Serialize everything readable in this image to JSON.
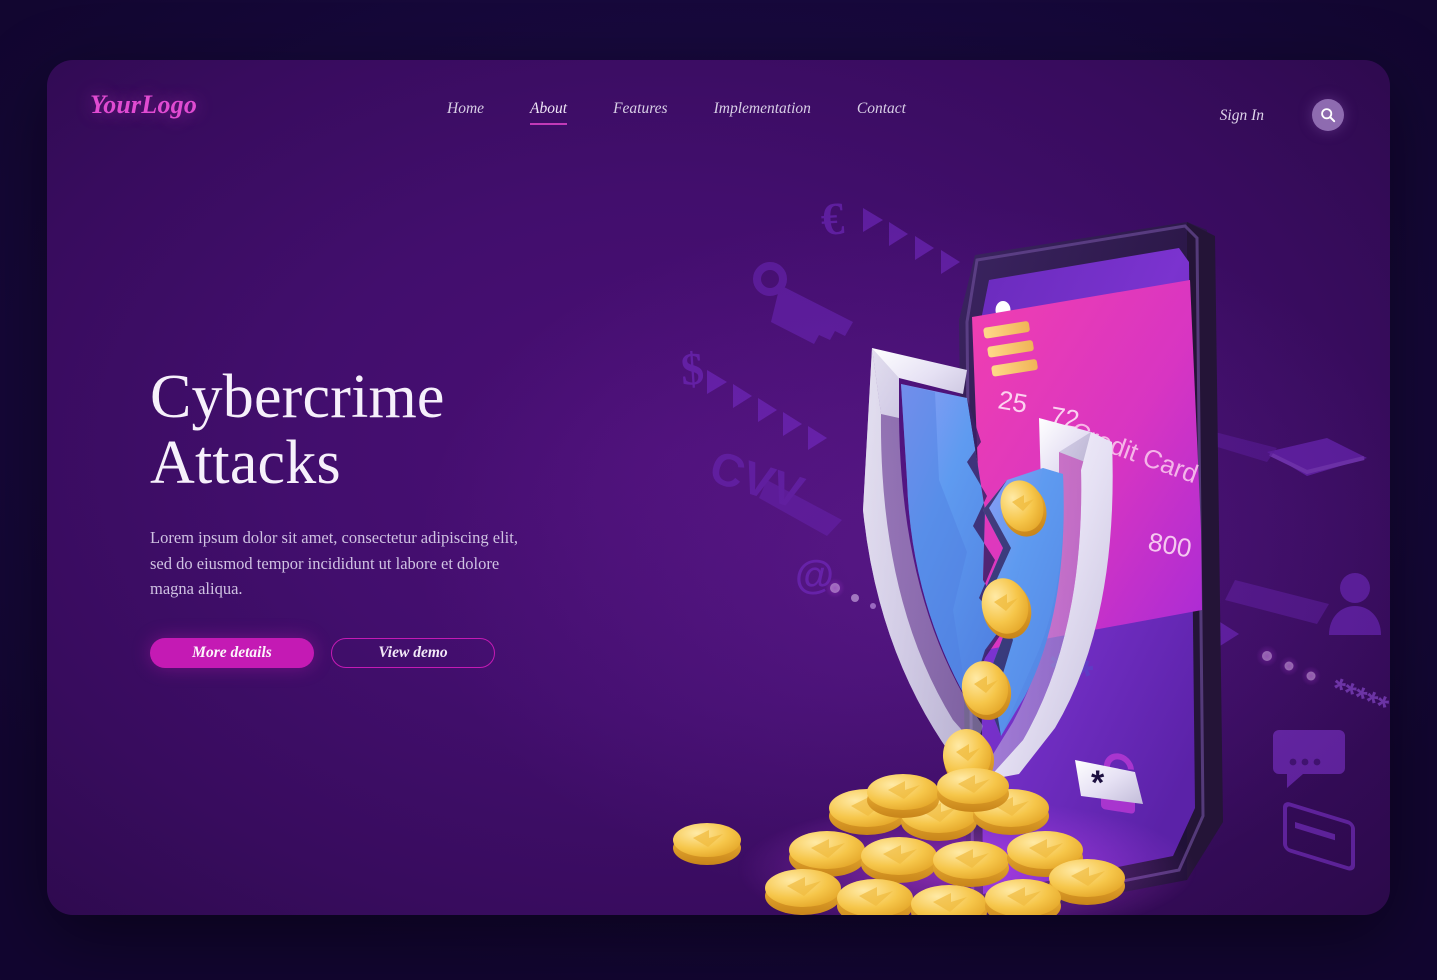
{
  "page": {
    "background_color": "#190a42",
    "card_color": "#420e6d",
    "accent_color": "#c41ab4",
    "logo_color": "#e04bd2"
  },
  "header": {
    "logo": "YourLogo",
    "nav": [
      {
        "label": "Home",
        "active": false
      },
      {
        "label": "About",
        "active": true
      },
      {
        "label": "Features",
        "active": false
      },
      {
        "label": "Implementation",
        "active": false
      },
      {
        "label": "Contact",
        "active": false
      }
    ],
    "signin_label": "Sign In",
    "search_icon": "search-icon"
  },
  "hero": {
    "headline_line1": "Cybercrime",
    "headline_line2": "Attacks",
    "paragraph": "Lorem ipsum dolor sit amet, consectetur adipiscing elit, sed do eiusmod tempor incididunt ut labore et dolore magna aliqua.",
    "primary_button": "More details",
    "secondary_button": "View demo"
  },
  "illustration": {
    "name": "isometric-cybercrime-scene",
    "phone": {
      "screen_dots": 3,
      "shield_icon": "shield-icon",
      "menu_icon": "hamburger-menu-icon",
      "unlock_icon": "unlocked-padlock-icon"
    },
    "credit_card": {
      "label": "Credit Card",
      "number_fragment_1": "25",
      "number_fragment_2": "72",
      "number_fragment_3": "800",
      "chip_icon": "card-chip-icon"
    },
    "broken_shield": {
      "name": "broken-shield-icon",
      "state": "cracked"
    },
    "coins": {
      "name": "gold-coin-pile",
      "spilling": true
    },
    "background_symbols": [
      {
        "name": "euro-symbol-icon",
        "label": "€"
      },
      {
        "name": "dollar-symbol-icon",
        "label": "$"
      },
      {
        "name": "key-icon",
        "label": "key"
      },
      {
        "name": "cvv-text",
        "label": "CVV"
      },
      {
        "name": "at-symbol-icon",
        "label": "@"
      },
      {
        "name": "envelope-icon",
        "label": "mail"
      },
      {
        "name": "user-avatar-icon",
        "label": "user"
      },
      {
        "name": "credit-card-outline-icon",
        "label": "card"
      },
      {
        "name": "password-asterisks",
        "label": "*****"
      },
      {
        "name": "chat-bubble-icon",
        "label": "chat"
      }
    ]
  }
}
